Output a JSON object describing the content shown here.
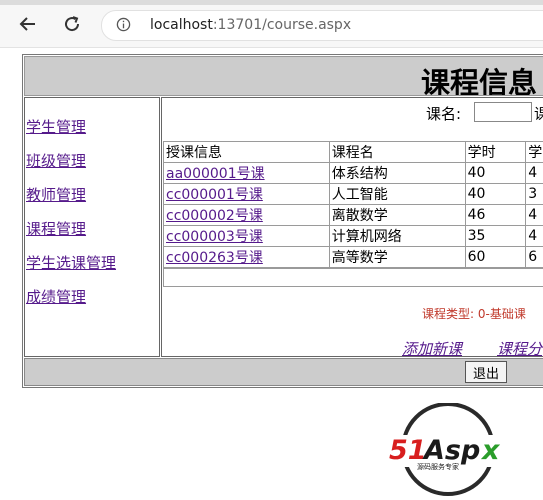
{
  "browser": {
    "url_host": "localhost",
    "url_path": ":13701/course.aspx"
  },
  "page": {
    "title": "课程信息"
  },
  "sidebar": {
    "items": [
      {
        "label": "学生管理"
      },
      {
        "label": "班级管理"
      },
      {
        "label": "教师管理"
      },
      {
        "label": "课程管理"
      },
      {
        "label": "学生选课管理"
      },
      {
        "label": "成绩管理"
      }
    ]
  },
  "search": {
    "label": "课名:",
    "value": "",
    "trailing_text": "课"
  },
  "table": {
    "headers": [
      "授课信息",
      "课程名",
      "学时",
      "学"
    ],
    "rows": [
      {
        "link": "aa000001号课",
        "name": "体系结构",
        "hours": "40",
        "credit": "4"
      },
      {
        "link": "cc000001号课",
        "name": "人工智能",
        "hours": "40",
        "credit": "3"
      },
      {
        "link": "cc000002号课",
        "name": "离散数学",
        "hours": "46",
        "credit": "4"
      },
      {
        "link": "cc000003号课",
        "name": "计算机网络",
        "hours": "35",
        "credit": "4"
      },
      {
        "link": "cc000263号课",
        "name": "高等数学",
        "hours": "60",
        "credit": "6"
      }
    ]
  },
  "note": "课程类型: 0-基础课",
  "actions": {
    "add": "添加新课",
    "category": "课程分"
  },
  "footer": {
    "exit_label": "退出"
  },
  "watermark": {
    "brand": "51Aspx",
    "tagline": "源码服务专家"
  },
  "colors": {
    "link": "#551a8b",
    "note": "#c0392b",
    "bar": "#cccccc"
  }
}
